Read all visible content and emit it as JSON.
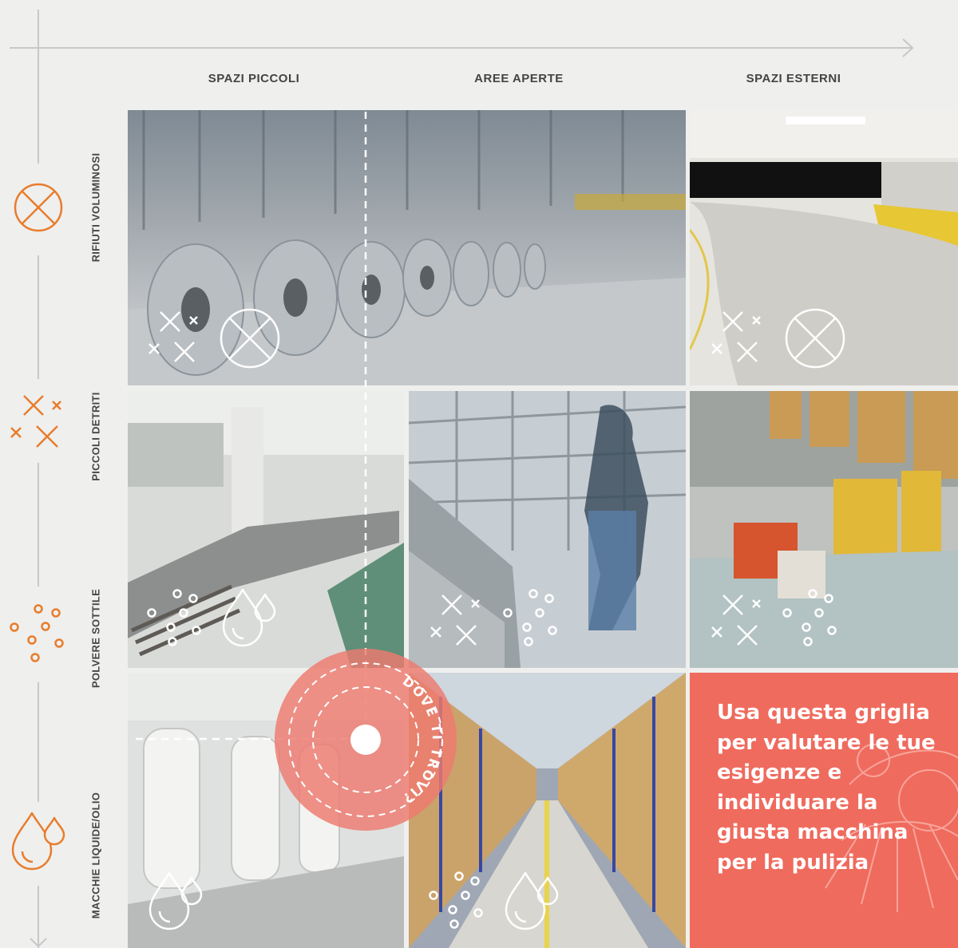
{
  "columns": {
    "small_spaces": "SPAZI PICCOLI",
    "open_areas": "AREE APERTE",
    "outdoor_spaces": "SPAZI ESTERNI"
  },
  "rows": {
    "bulky_waste": "RIFIUTI VOLUMINOSI",
    "small_debris": "PICCOLI DETRITI",
    "fine_dust": "POLVERE SOTTILE",
    "liquid_oil_stains": "MACCHIE LIQUIDE/OLIO"
  },
  "pin": {
    "label": "DOVE TI TROVI?"
  },
  "cta": {
    "text": "Usa questa griglia per valutare le tue esigenze e individuare la giusta macchina per la pulizia"
  },
  "icons": {
    "bulky_waste": "crossed-circle-icon",
    "small_debris": "scattered-x-icon",
    "fine_dust": "dots-icon",
    "liquid_oil_stains": "droplets-icon"
  },
  "colors": {
    "accent_orange": "#e87d2c",
    "cta_red": "#ef6b5e",
    "pin_red": "#ee7a6f"
  }
}
